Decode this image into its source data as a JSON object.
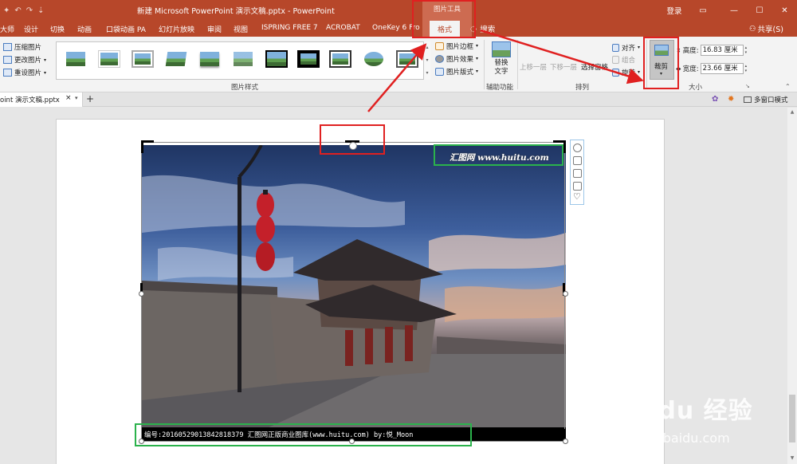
{
  "window": {
    "title": "新建 Microsoft PowerPoint 演示文稿.pptx - PowerPoint",
    "context_group": "图片工具",
    "login": "登录"
  },
  "tabs": [
    "大师",
    "设计",
    "切换",
    "动画",
    "口袋动画 PA",
    "幻灯片放映",
    "审阅",
    "视图",
    "ISPRING FREE 7",
    "ACROBAT",
    "OneKey 6 Fro",
    "格式"
  ],
  "active_tab": "格式",
  "tell_me": "搜索",
  "share": "共享(S)",
  "ribbon": {
    "adjust": [
      "压缩图片",
      "更改图片",
      "重设图片"
    ],
    "picture_styles_label": "图片样式",
    "style_commands": [
      "图片边框",
      "图片效果",
      "图片版式"
    ],
    "accessibility": {
      "button": "替换文字",
      "label": "辅助功能"
    },
    "arrange": {
      "bring_forward": "上移一层",
      "send_backward": "下移一层",
      "selection_pane": "选择窗格",
      "align": "对齐",
      "group": "组合",
      "rotate": "旋转",
      "label": "排列"
    },
    "crop": "裁剪",
    "size": {
      "label": "大小",
      "height_label": "高度:",
      "height_value": "16.83 厘米",
      "width_label": "宽度:",
      "width_value": "23.66 厘米"
    }
  },
  "doc_tab": {
    "name": "oint 演示文稿.pptx",
    "close": "×",
    "new": "+",
    "multi_window": "多窗口模式"
  },
  "picture": {
    "watermark": "汇图网 www.huitu.com",
    "caption": "编号:20160529013842818379  汇图网正版商业图库(www.huitu.com) by:悦_Moon"
  },
  "page_watermark": {
    "brand": "Baidu 经验",
    "url": "jingyan.baidu.com"
  },
  "colors": {
    "accent": "#b7472a",
    "context_tab": "#cd6b51",
    "annotation_red": "#e02020",
    "annotation_green": "#2bb24c"
  }
}
